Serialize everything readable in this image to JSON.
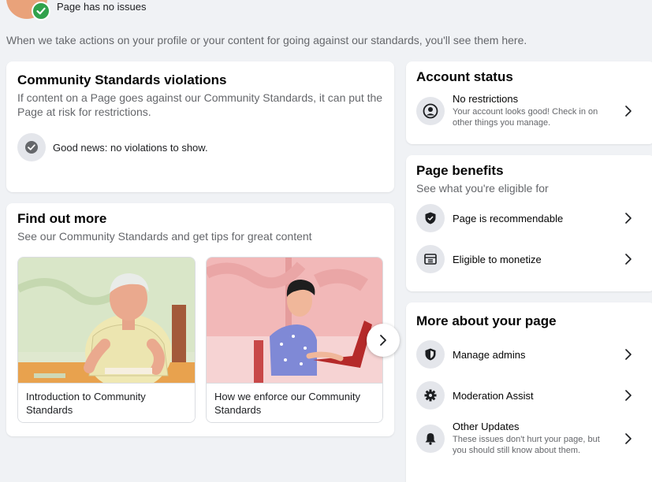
{
  "header": {
    "page_status": "Page has no issues",
    "intro": "When we take actions on your profile or your content for going against our standards, you'll see them here."
  },
  "violations": {
    "title": "Community Standards violations",
    "description": "If content on a Page goes against our Community Standards, it can put the Page at risk for restrictions.",
    "status": "Good news: no violations to show."
  },
  "find_out_more": {
    "title": "Find out more",
    "subtitle": "See our Community Standards and get tips for great content",
    "tiles": [
      {
        "caption": "Introduction to Community Standards"
      },
      {
        "caption": "How we enforce our Community Standards"
      }
    ]
  },
  "account_status": {
    "title": "Account status",
    "label": "No restrictions",
    "description": "Your account looks good! Check in on other things you manage."
  },
  "page_benefits": {
    "title": "Page benefits",
    "subtitle": "See what you're eligible for",
    "items": [
      {
        "label": "Page is recommendable",
        "icon": "shield-icon"
      },
      {
        "label": "Eligible to monetize",
        "icon": "monetize-icon"
      }
    ]
  },
  "more_about": {
    "title": "More about your page",
    "items": [
      {
        "label": "Manage admins",
        "icon": "shield-icon"
      },
      {
        "label": "Moderation Assist",
        "icon": "gear-icon"
      },
      {
        "label": "Other Updates",
        "description": "These issues don't hurt your page, but you should still know about them.",
        "icon": "bell-icon"
      }
    ]
  },
  "colors": {
    "background": "#f0f2f5",
    "card": "#ffffff",
    "check_green": "#31a24c",
    "secondary_text": "#65676b"
  }
}
